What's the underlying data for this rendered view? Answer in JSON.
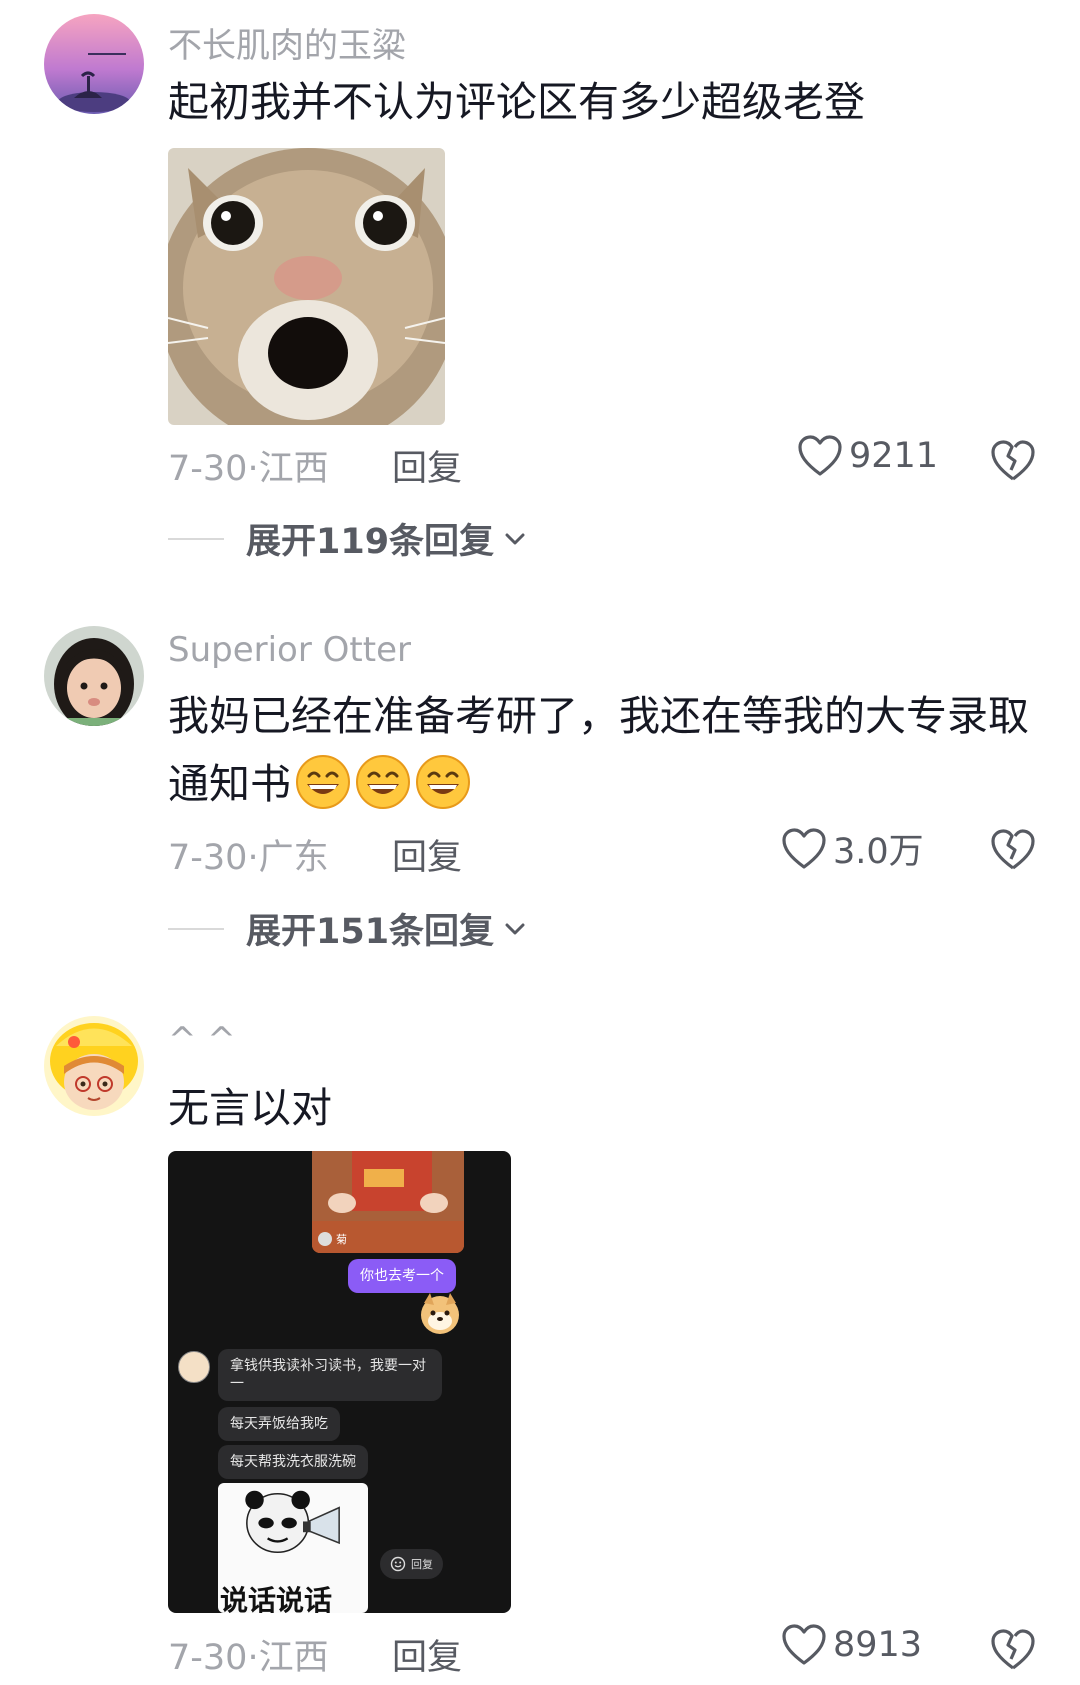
{
  "comments": [
    {
      "username": "不长肌肉的玉粱",
      "text": "起初我并不认为评论区有多少超级老登",
      "date": "7-30",
      "location": "江西",
      "reply_label": "回复",
      "likes": "9211",
      "expand_label": "展开119条回复"
    },
    {
      "username": "Superior Otter",
      "text": "我妈已经在准备考研了，我还在等我的大专录取",
      "text_line2": "通知书",
      "date": "7-30",
      "location": "广东",
      "reply_label": "回复",
      "likes": "3.0万",
      "expand_label": "展开151条回复"
    },
    {
      "username": "^ ^",
      "text": "无言以对",
      "date": "7-30",
      "location": "江西",
      "reply_label": "回复",
      "likes": "8913"
    }
  ],
  "embedded_chat": {
    "sender_tag": "菊",
    "outgoing_message": "你也去考一个",
    "incoming_messages": [
      "拿钱供我读补习读书，我要一对一",
      "每天弄饭给我吃",
      "每天帮我洗衣服洗碗"
    ],
    "sticker_caption": "说话说话",
    "reply_chip": "回复"
  },
  "colors": {
    "meta_gray": "#a3a5ab",
    "text_dark": "#161823",
    "chat_purple": "#8b5cf6"
  }
}
